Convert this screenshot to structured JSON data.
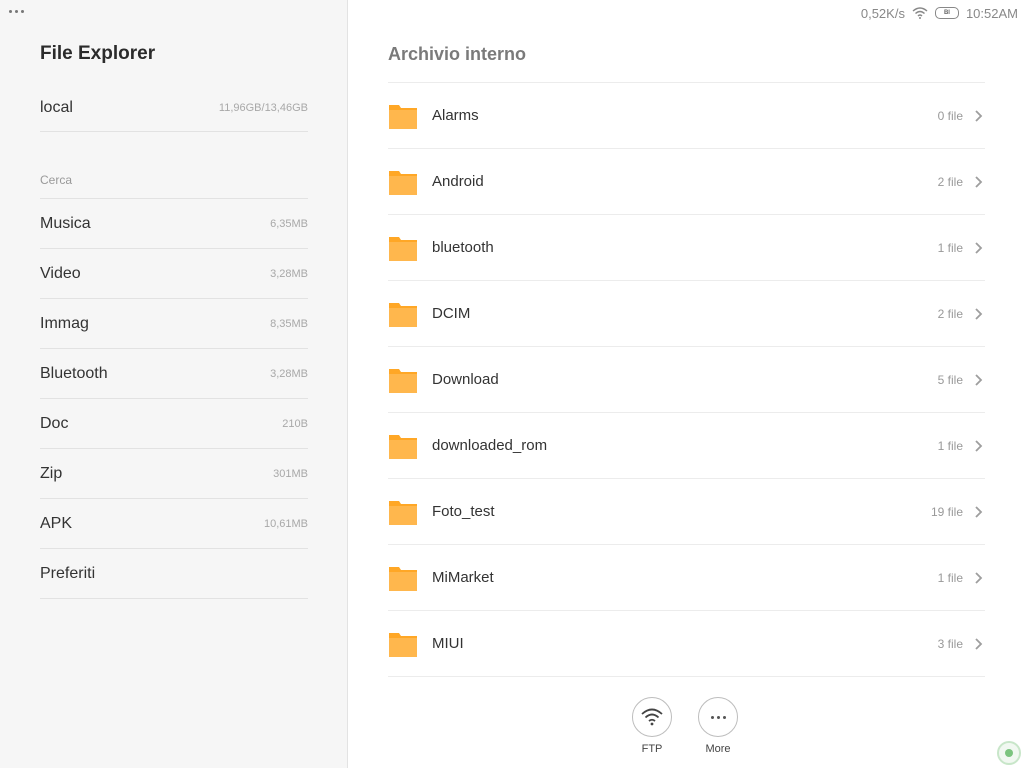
{
  "status_bar": {
    "speed": "0,52K/s",
    "battery": "BI",
    "time": "10:52AM"
  },
  "sidebar": {
    "title": "File Explorer",
    "storage": {
      "label": "local",
      "size": "11,96GB/13,46GB"
    },
    "section_label": "Cerca",
    "categories": [
      {
        "label": "Musica",
        "size": "6,35MB"
      },
      {
        "label": "Video",
        "size": "3,28MB"
      },
      {
        "label": "Immag",
        "size": "8,35MB"
      },
      {
        "label": "Bluetooth",
        "size": "3,28MB"
      },
      {
        "label": "Doc",
        "size": "210B"
      },
      {
        "label": "Zip",
        "size": "301MB"
      },
      {
        "label": "APK",
        "size": "10,61MB"
      },
      {
        "label": "Preferiti",
        "size": ""
      }
    ]
  },
  "main": {
    "title": "Archivio interno",
    "folders": [
      {
        "name": "Alarms",
        "count": "0 file"
      },
      {
        "name": "Android",
        "count": "2 file"
      },
      {
        "name": "bluetooth",
        "count": "1 file"
      },
      {
        "name": "DCIM",
        "count": "2 file"
      },
      {
        "name": "Download",
        "count": "5 file"
      },
      {
        "name": "downloaded_rom",
        "count": "1 file"
      },
      {
        "name": "Foto_test",
        "count": "19 file"
      },
      {
        "name": "MiMarket",
        "count": "1 file"
      },
      {
        "name": "MIUI",
        "count": "3 file"
      }
    ]
  },
  "actions": {
    "ftp_label": "FTP",
    "more_label": "More"
  },
  "colors": {
    "folder": "#ffb74d",
    "folder_tab": "#ffa726",
    "sidebar_bg": "#f6f6f6"
  }
}
